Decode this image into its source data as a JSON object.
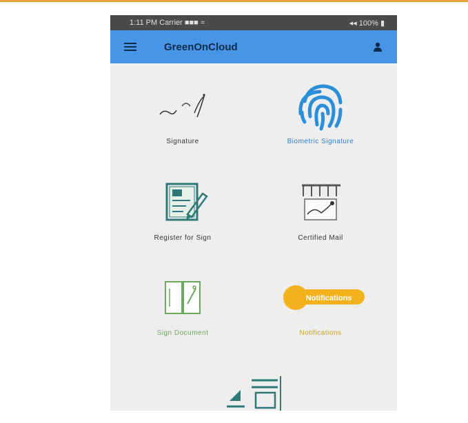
{
  "status_bar": {
    "left_text": "1:11 PM Carrier  ■■■ ≈",
    "right_text": "◂◂ 100% ▮"
  },
  "appbar": {
    "title": "GreenOnCloud"
  },
  "tiles": [
    {
      "label": "Signature",
      "icon": "signature-icon"
    },
    {
      "label": "Biometric Signature",
      "icon": "fingerprint-icon"
    },
    {
      "label": "Register for Sign",
      "icon": "register-notebook-icon"
    },
    {
      "label": "Certified Mail",
      "icon": "certified-mail-icon"
    },
    {
      "label": "Sign Document",
      "icon": "sign-document-icon"
    },
    {
      "label": "Notifications",
      "icon": "notifications-banner-icon",
      "banner_text": "Notifications"
    }
  ],
  "bottom_tile": {
    "icon": "document-list-icon"
  },
  "colors": {
    "accent_orange": "#e8a23a",
    "appbar_blue": "#4795e4",
    "status_bar": "#4a4a4a",
    "content_bg": "#eeeeee",
    "fingerprint_blue": "#2a8ed8",
    "teal": "#2f7a78",
    "green": "#6aa85a",
    "yellow": "#f2b21b"
  }
}
